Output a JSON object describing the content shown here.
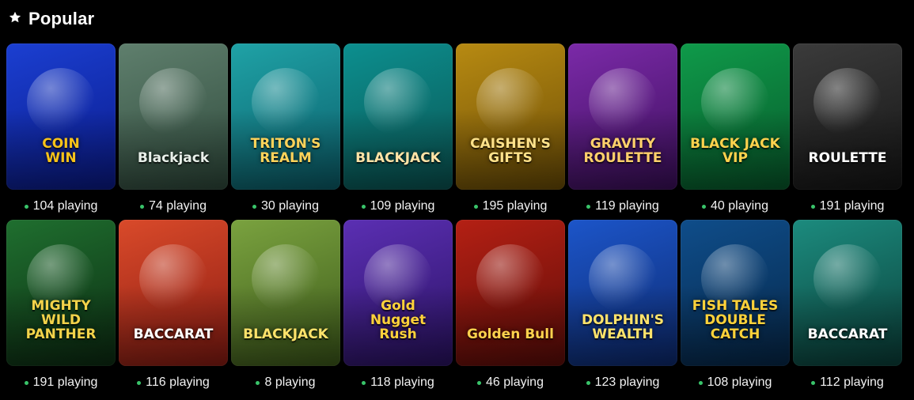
{
  "section": {
    "title": "Popular",
    "icon": "star-icon"
  },
  "rows": [
    [
      {
        "name": "COIN\nWIN",
        "playing": "104 playing",
        "bg": "#1b3fd1",
        "bg2": "#0a1a8a",
        "accent": "#f7c21a"
      },
      {
        "name": "Blackjack",
        "playing": "74 playing",
        "bg": "#5f7f6d",
        "bg2": "#2f4a3c",
        "accent": "#e8efe9"
      },
      {
        "name": "TRITON'S\nREALM",
        "playing": "30 playing",
        "bg": "#1fa2a6",
        "bg2": "#0b5e6a",
        "accent": "#ffd35a"
      },
      {
        "name": "BLACKJACK",
        "playing": "109 playing",
        "bg": "#0c8f8f",
        "bg2": "#0a5553",
        "accent": "#ffe3a6"
      },
      {
        "name": "CAISHEN'S\nGIFTS",
        "playing": "195 playing",
        "bg": "#b78a12",
        "bg2": "#6d4e06",
        "accent": "#ffe28a"
      },
      {
        "name": "GRAVITY\nROULETTE",
        "playing": "119 playing",
        "bg": "#7b2aa8",
        "bg2": "#3c0f5c",
        "accent": "#ffd16b"
      },
      {
        "name": "BLACK JACK\nVIP",
        "playing": "40 playing",
        "bg": "#0f9a4a",
        "bg2": "#075a2b",
        "accent": "#ffd24d"
      },
      {
        "name": "ROULETTE",
        "playing": "191 playing",
        "bg": "#3b3b3b",
        "bg2": "#151515",
        "accent": "#ffffff"
      }
    ],
    [
      {
        "name": "MIGHTY WILD\nPANTHER",
        "playing": "191 playing",
        "bg": "#1f6f2f",
        "bg2": "#0c2c12",
        "accent": "#f3d34a"
      },
      {
        "name": "BACCARAT",
        "playing": "116 playing",
        "bg": "#d94a2a",
        "bg2": "#8b1b12",
        "accent": "#ffffff"
      },
      {
        "name": "BLACKJACK",
        "playing": "8 playing",
        "bg": "#7aa23f",
        "bg2": "#3d5a1a",
        "accent": "#ffe36b"
      },
      {
        "name": "Gold\nNugget\nRush",
        "playing": "118 playing",
        "bg": "#5b2fb3",
        "bg2": "#2a1263",
        "accent": "#ffd23a"
      },
      {
        "name": "Golden Bull",
        "playing": "46 playing",
        "bg": "#b42014",
        "bg2": "#5e0c08",
        "accent": "#ffd24d"
      },
      {
        "name": "DOLPHIN'S\nWEALTH",
        "playing": "123 playing",
        "bg": "#1c55c9",
        "bg2": "#0d2a6f",
        "accent": "#ffe36b"
      },
      {
        "name": "FISH TALES\nDOUBLE CATCH",
        "playing": "108 playing",
        "bg": "#0f4d8a",
        "bg2": "#06284a",
        "accent": "#ffd23a"
      },
      {
        "name": "BACCARAT",
        "playing": "112 playing",
        "bg": "#1c8b7e",
        "bg2": "#0a3f39",
        "accent": "#ffffff"
      }
    ]
  ]
}
